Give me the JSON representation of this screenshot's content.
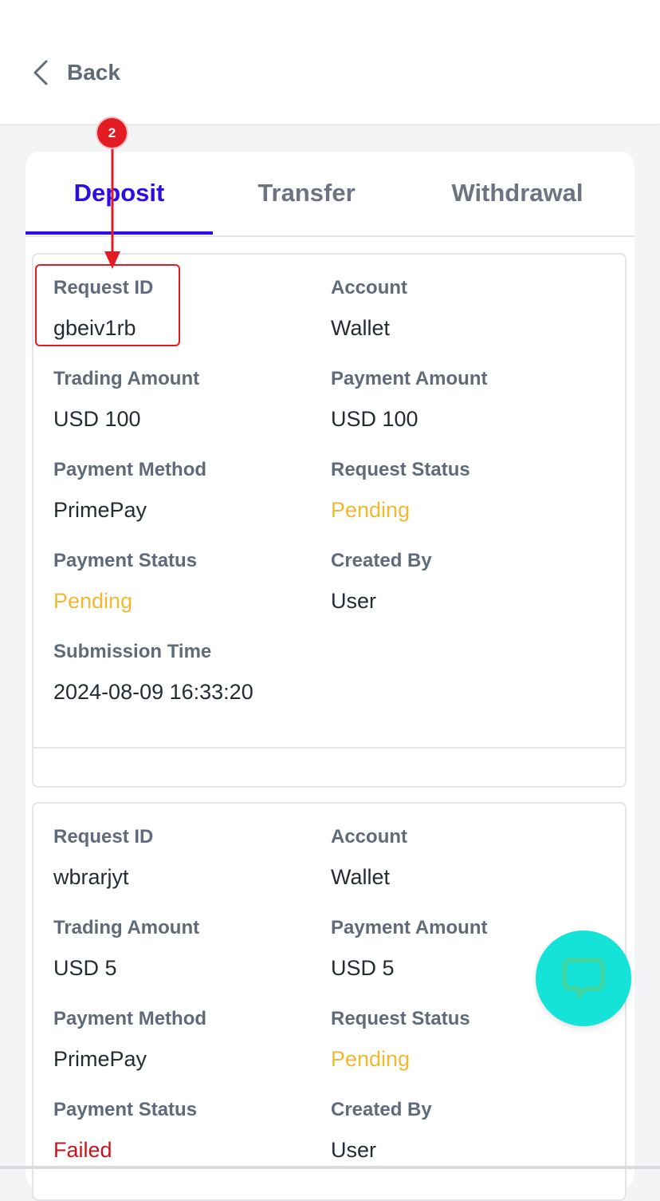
{
  "header": {
    "back_label": "Back"
  },
  "tabs": [
    {
      "label": "Deposit",
      "active": true
    },
    {
      "label": "Transfer",
      "active": false
    },
    {
      "label": "Withdrawal",
      "active": false
    }
  ],
  "records": [
    {
      "request_id_label": "Request ID",
      "request_id": "gbeiv1rb",
      "account_label": "Account",
      "account": "Wallet",
      "trading_amount_label": "Trading Amount",
      "trading_amount": "USD 100",
      "payment_amount_label": "Payment Amount",
      "payment_amount": "USD 100",
      "payment_method_label": "Payment Method",
      "payment_method": "PrimePay",
      "request_status_label": "Request Status",
      "request_status": "Pending",
      "payment_status_label": "Payment Status",
      "payment_status": "Pending",
      "created_by_label": "Created By",
      "created_by": "User",
      "submission_time_label": "Submission Time",
      "submission_time": "2024-08-09 16:33:20"
    },
    {
      "request_id_label": "Request ID",
      "request_id": "wbrarjyt",
      "account_label": "Account",
      "account": "Wallet",
      "trading_amount_label": "Trading Amount",
      "trading_amount": "USD 5",
      "payment_amount_label": "Payment Amount",
      "payment_amount": "USD 5",
      "payment_method_label": "Payment Method",
      "payment_method": "PrimePay",
      "request_status_label": "Request Status",
      "request_status": "Pending",
      "payment_status_label": "Payment Status",
      "payment_status": "Failed",
      "created_by_label": "Created By",
      "created_by": "User"
    }
  ],
  "annotation": {
    "step_number": "2"
  },
  "colors": {
    "accent": "#2b0ee6",
    "pending": "#f0b931",
    "failed": "#c4161c",
    "annotation": "#e31b23",
    "chat_button": "#15e3d8"
  },
  "icons": {
    "back": "chevron-left-icon",
    "chat": "chat-bubble-icon"
  }
}
